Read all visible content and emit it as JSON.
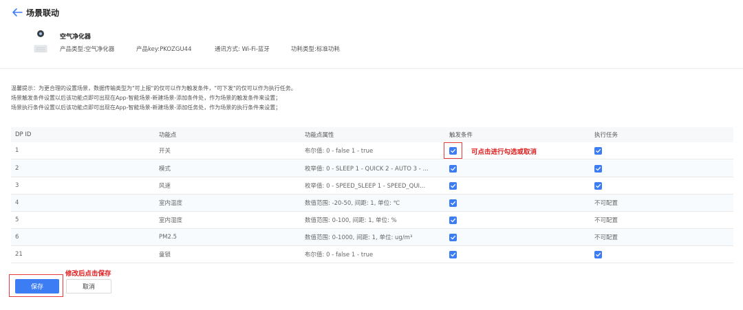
{
  "header": {
    "title": "场景联动",
    "product": {
      "name": "空气净化器",
      "type": "产品类型:空气净化器",
      "key": "产品key:PKOZGU44",
      "comm": "通讯方式: Wi-Fi-蓝牙",
      "power": "功耗类型:标准功耗"
    }
  },
  "tips": [
    "温馨提示：为更合理的设置场景，数据传输类型为\"可上报\"的仅可以作为触发条件，\"可下发\"的仅可以作为执行任务。",
    "场景触发条件设置以后该功能点即可出现在App-智能场景-新建场景-添加条件处，作为场景的触发条件来设置；",
    "场景执行条件设置以后该功能点即可出现在App-智能场景-新建场景-添加任务处，作为场景的执行条件来设置；"
  ],
  "table": {
    "columns": [
      "DP ID",
      "功能点",
      "功能点属性",
      "触发条件",
      "执行任务"
    ],
    "rows": [
      {
        "id": "1",
        "name": "开关",
        "attr": "布尔值:  0 - false 1 - true",
        "trigger": true,
        "action": true,
        "action_text": ""
      },
      {
        "id": "2",
        "name": "模式",
        "attr": "枚举值:  0 - SLEEP 1 - QUICK 2 - AUTO 3 - ...",
        "trigger": true,
        "action": true,
        "action_text": ""
      },
      {
        "id": "3",
        "name": "风速",
        "attr": "枚举值:  0 - SPEED_SLEEP 1 - SPEED_QUI...",
        "trigger": true,
        "action": true,
        "action_text": ""
      },
      {
        "id": "4",
        "name": "室内温度",
        "attr": "数值范围: -20-50, 间距: 1, 单位: ℃",
        "trigger": true,
        "action": false,
        "action_text": "不可配置"
      },
      {
        "id": "5",
        "name": "室内湿度",
        "attr": "数值范围: 0-100, 间距: 1, 单位: %",
        "trigger": true,
        "action": false,
        "action_text": "不可配置"
      },
      {
        "id": "6",
        "name": "PM2.5",
        "attr": "数值范围: 0-1000, 间距: 1, 单位: ug/m³",
        "trigger": true,
        "action": false,
        "action_text": "不可配置"
      },
      {
        "id": "21",
        "name": "童锁",
        "attr": "布尔值:  0 - false 1 - true",
        "trigger": true,
        "action": true,
        "action_text": ""
      }
    ]
  },
  "annotations": {
    "checkbox_hint": "可点击进行勾选或取消",
    "save_hint": "修改后点击保存"
  },
  "buttons": {
    "save": "保存",
    "cancel": "取消"
  },
  "colors": {
    "accent": "#3d7df3",
    "annotation": "#e02020"
  }
}
